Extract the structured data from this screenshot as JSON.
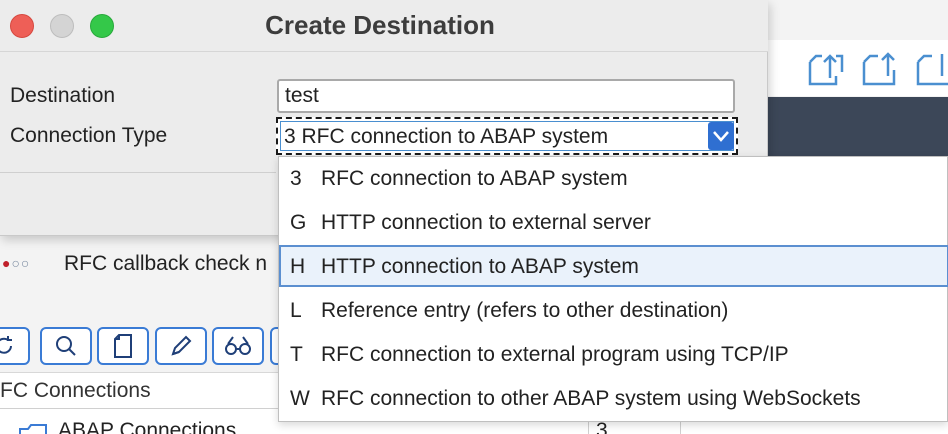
{
  "dialog": {
    "title": "Create Destination",
    "destination_label": "Destination",
    "destination_value": "test",
    "connection_type_label": "Connection Type",
    "connection_type_selected": "3  RFC connection to ABAP system"
  },
  "dropdown": {
    "options": [
      {
        "code": "3",
        "text": "RFC connection to ABAP system"
      },
      {
        "code": "G",
        "text": "HTTP connection to external server"
      },
      {
        "code": "H",
        "text": "HTTP connection to ABAP system"
      },
      {
        "code": "L",
        "text": "Reference entry (refers to other destination)"
      },
      {
        "code": "T",
        "text": "RFC connection to external program using TCP/IP"
      },
      {
        "code": "W",
        "text": "RFC connection to other ABAP system using WebSockets"
      }
    ],
    "highlighted_code": "H"
  },
  "background": {
    "callback_text": "RFC callback check n",
    "table_header": "FC Connections",
    "row_label": "ABAP Connections",
    "row_value": "3"
  },
  "icons": {
    "toolbar": [
      "export-icon",
      "upload-icon",
      "download-icon"
    ],
    "buttons": [
      "refresh-icon",
      "search-icon",
      "new-document-icon",
      "edit-icon",
      "display-icon"
    ]
  },
  "colors": {
    "accent": "#2f6fd1",
    "close": "#ee5f57",
    "maximize": "#34c849",
    "selection_bg": "#eaf2fb"
  }
}
